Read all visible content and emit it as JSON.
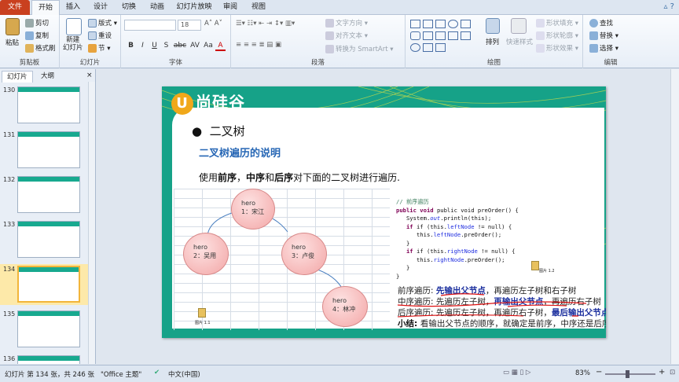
{
  "tabs": [
    "文件",
    "开始",
    "插入",
    "设计",
    "切换",
    "动画",
    "幻灯片放映",
    "审阅",
    "视图"
  ],
  "ribbon": {
    "clipboard": {
      "paste": "粘贴",
      "cut": "剪切",
      "copy": "复制",
      "format_painter": "格式刷",
      "label": "剪贴板"
    },
    "slides": {
      "new_slide": "新建\n幻灯片",
      "layout": "版式",
      "reset": "重设",
      "section": "节",
      "label": "幻灯片"
    },
    "font": {
      "label": "字体",
      "size": "18",
      "bold": "B",
      "italic": "I",
      "underline": "U",
      "shadow": "S",
      "strike": "abc",
      "spacing": "AV",
      "case": "Aa",
      "color": "A"
    },
    "paragraph": {
      "label": "段落",
      "text_direction": "文字方向",
      "align_text": "对齐文本",
      "smartart": "转换为 SmartArt"
    },
    "drawing": {
      "label": "绘图",
      "arrange": "排列",
      "quick_styles": "快速样式",
      "fill": "形状填充",
      "outline": "形状轮廓",
      "effects": "形状效果"
    },
    "editing": {
      "label": "编辑",
      "find": "查找",
      "replace": "替换",
      "select": "选择"
    }
  },
  "leftpane": {
    "tab_slides": "幻灯片",
    "tab_outline": "大纲",
    "close": "×",
    "thumbs": [
      {
        "num": "130"
      },
      {
        "num": "131"
      },
      {
        "num": "132"
      },
      {
        "num": "133"
      },
      {
        "num": "134"
      },
      {
        "num": "135"
      },
      {
        "num": "136"
      }
    ]
  },
  "slide": {
    "logo": "尚硅谷",
    "logo_mark": "U",
    "bullet": "二叉树",
    "heading": "二叉树遍历的说明",
    "intro_parts": [
      "使用",
      "前序",
      "，",
      "中序",
      "和",
      "后序",
      "对下面的二叉树进行遍历."
    ],
    "nodes": [
      {
        "line1": "hero",
        "line2": "1：宋江"
      },
      {
        "line1": "hero",
        "line2": "2：吴用"
      },
      {
        "line1": "hero",
        "line2": "3：卢俊"
      },
      {
        "line1": "hero",
        "line2": "4：林冲"
      }
    ],
    "file_label_1": "图片 1.1",
    "file_label_2": "图片 1.2",
    "code": {
      "comment": "// 前序遍历",
      "l1": "public void preOrder() {",
      "l2a": "System.",
      "l2b": "out",
      "l2c": ".println(this);",
      "l3a": "if (this.",
      "l3b": "leftNode",
      "l3c": " != null) {",
      "l4a": "this.",
      "l4b": "leftNode",
      "l4c": ".preOrder();",
      "l5": "}",
      "l6a": "if (this.",
      "l6b": "rightNode",
      "l6c": " != null) {",
      "l7a": "this.",
      "l7b": "rightNode",
      "l7c": ".preOrder();",
      "l8": "}",
      "l9": "}"
    },
    "desc": [
      {
        "a": "前序遍历: ",
        "b": "先输出父节点",
        "c": "，再遍历左子树和右子树"
      },
      {
        "a": "中序遍历: 先遍历左子树，",
        "b": "再输出父节点",
        "c": "，再遍历右子树"
      },
      {
        "a": "后序遍历: 先遍历左子树，再遍历右子树，",
        "b": "最后输出父节点",
        "c": ""
      },
      {
        "a": "小结: ",
        "b": "",
        "c": "看输出父节点的顺序，就确定是前序，中序还是后序"
      }
    ]
  },
  "status": {
    "slide_info": "幻灯片 第 134 张，共 246 张",
    "theme": "\"Office 主题\"",
    "language": "中文(中国)",
    "zoom": "83%",
    "minus": "−",
    "plus": "+"
  }
}
